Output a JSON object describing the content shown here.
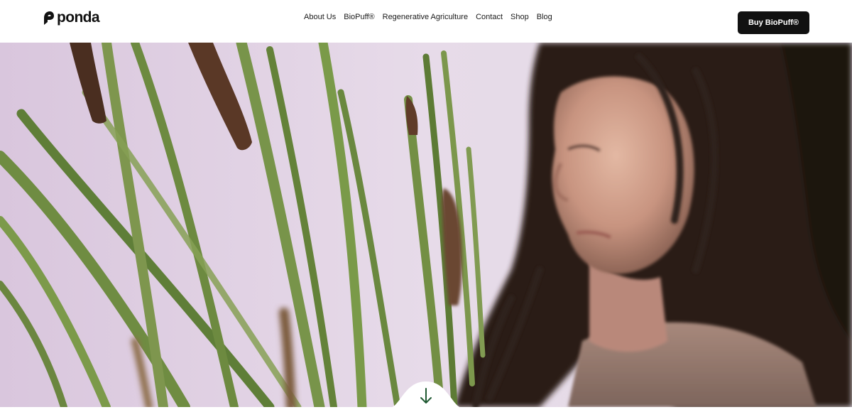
{
  "header": {
    "logo_text": "ponda",
    "nav": [
      {
        "label": "About Us"
      },
      {
        "label": "BioPuff®"
      },
      {
        "label": "Regenerative Agriculture"
      },
      {
        "label": "Contact"
      },
      {
        "label": "Shop"
      },
      {
        "label": "Blog"
      }
    ],
    "cta_label": "Buy BioPuff®"
  },
  "hero": {
    "image": "woman-among-cattail-reeds"
  },
  "scroll_button": {
    "icon": "arrow-down-icon",
    "color": "#1f5a32"
  }
}
